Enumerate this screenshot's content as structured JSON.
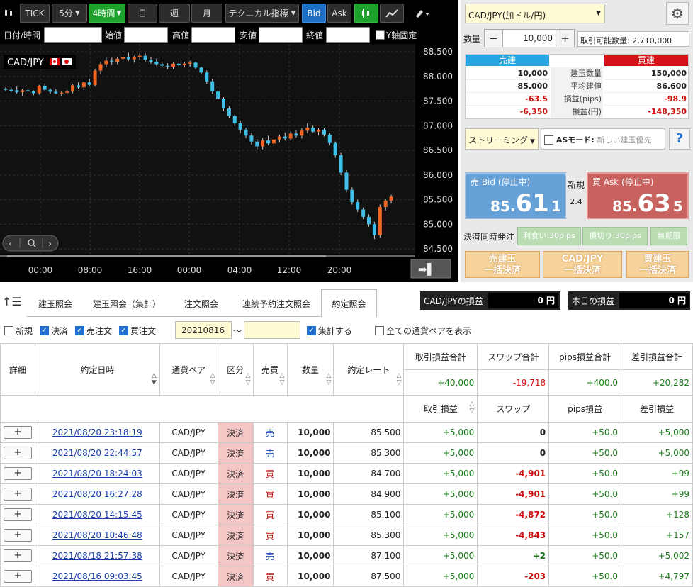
{
  "toolbar": {
    "tick": "TICK",
    "interval": "5分",
    "interval_active": "4時間",
    "day": "日",
    "week": "週",
    "month": "月",
    "indicator": "テクニカル指標",
    "bid": "Bid",
    "ask": "Ask"
  },
  "filter_row": {
    "datetime": "日付/時間",
    "open": "始値",
    "high": "高値",
    "low": "安値",
    "close": "終値",
    "y_fixed": "Y軸固定"
  },
  "chart_data": {
    "type": "candlestick",
    "symbol_label": "CAD/JPY",
    "ylim": [
      84.4,
      88.66
    ],
    "y_ticks": [
      "88.500",
      "88.000",
      "87.500",
      "87.000",
      "86.500",
      "86.000",
      "85.500",
      "85.000",
      "84.500"
    ],
    "x_ticks": [
      "00:00",
      "08:00",
      "16:00",
      "00:00",
      "04:00",
      "12:00",
      "20:00"
    ],
    "candles": [
      [
        87.75,
        87.78,
        87.7,
        87.73
      ],
      [
        87.73,
        87.77,
        87.68,
        87.72
      ],
      [
        87.72,
        87.8,
        87.65,
        87.68
      ],
      [
        87.68,
        87.75,
        87.6,
        87.72
      ],
      [
        87.72,
        87.8,
        87.66,
        87.7
      ],
      [
        87.7,
        87.72,
        87.62,
        87.66
      ],
      [
        87.66,
        87.83,
        87.63,
        87.81
      ],
      [
        87.81,
        87.86,
        87.71,
        87.73
      ],
      [
        87.73,
        87.76,
        87.65,
        87.69
      ],
      [
        87.69,
        87.74,
        87.64,
        87.66
      ],
      [
        87.66,
        87.7,
        87.61,
        87.67
      ],
      [
        87.67,
        87.72,
        87.62,
        87.7
      ],
      [
        87.7,
        87.84,
        87.66,
        87.82
      ],
      [
        87.82,
        87.88,
        87.75,
        87.78
      ],
      [
        87.78,
        87.9,
        87.72,
        87.88
      ],
      [
        87.88,
        87.95,
        87.8,
        87.83
      ],
      [
        87.83,
        88.15,
        87.8,
        88.12
      ],
      [
        88.12,
        88.3,
        88.05,
        88.25
      ],
      [
        88.25,
        88.4,
        88.18,
        88.32
      ],
      [
        88.32,
        88.38,
        88.24,
        88.3
      ],
      [
        88.3,
        88.4,
        88.25,
        88.36
      ],
      [
        88.36,
        88.45,
        88.3,
        88.4
      ],
      [
        88.4,
        88.48,
        88.32,
        88.35
      ],
      [
        88.35,
        88.42,
        88.28,
        88.4
      ],
      [
        88.4,
        88.47,
        88.33,
        88.42
      ],
      [
        88.42,
        88.47,
        88.3,
        88.34
      ],
      [
        88.34,
        88.4,
        88.26,
        88.3
      ],
      [
        88.3,
        88.36,
        88.22,
        88.25
      ],
      [
        88.25,
        88.3,
        88.18,
        88.22
      ],
      [
        88.22,
        88.27,
        88.15,
        88.2
      ],
      [
        88.2,
        88.28,
        88.15,
        88.26
      ],
      [
        88.26,
        88.32,
        88.2,
        88.23
      ],
      [
        88.23,
        88.3,
        88.18,
        88.26
      ],
      [
        88.26,
        88.32,
        88.2,
        88.28
      ],
      [
        88.28,
        88.3,
        88.15,
        88.18
      ],
      [
        88.18,
        88.2,
        88.05,
        88.08
      ],
      [
        88.08,
        88.12,
        87.85,
        87.9
      ],
      [
        87.9,
        87.95,
        87.65,
        87.7
      ],
      [
        87.7,
        87.73,
        87.5,
        87.55
      ],
      [
        87.55,
        87.58,
        87.3,
        87.35
      ],
      [
        87.35,
        87.4,
        87.15,
        87.2
      ],
      [
        87.2,
        87.23,
        87.0,
        87.05
      ],
      [
        87.05,
        87.1,
        86.85,
        86.92
      ],
      [
        86.92,
        86.96,
        86.75,
        86.8
      ],
      [
        86.8,
        86.85,
        86.62,
        86.68
      ],
      [
        86.68,
        86.73,
        86.52,
        86.58
      ],
      [
        86.58,
        86.75,
        86.52,
        86.7
      ],
      [
        86.7,
        86.8,
        86.6,
        86.64
      ],
      [
        86.64,
        86.78,
        86.58,
        86.72
      ],
      [
        86.72,
        86.82,
        86.66,
        86.78
      ],
      [
        86.78,
        86.86,
        86.7,
        86.74
      ],
      [
        86.74,
        86.88,
        86.7,
        86.84
      ],
      [
        86.84,
        86.9,
        86.76,
        86.8
      ],
      [
        86.8,
        86.95,
        86.74,
        86.9
      ],
      [
        86.9,
        87.05,
        86.85,
        86.96
      ],
      [
        86.96,
        87.0,
        86.86,
        86.88
      ],
      [
        86.88,
        86.95,
        86.8,
        86.92
      ],
      [
        86.92,
        86.95,
        86.78,
        86.82
      ],
      [
        86.82,
        86.85,
        86.6,
        86.65
      ],
      [
        86.65,
        86.68,
        86.35,
        86.4
      ],
      [
        86.4,
        86.45,
        86.0,
        86.05
      ],
      [
        86.05,
        86.1,
        85.65,
        85.7
      ],
      [
        85.7,
        85.75,
        85.4,
        85.45
      ],
      [
        85.45,
        85.5,
        85.25,
        85.3
      ],
      [
        85.3,
        85.34,
        85.1,
        85.15
      ],
      [
        85.15,
        85.2,
        84.95,
        85.0
      ],
      [
        85.0,
        85.05,
        84.7,
        84.78
      ],
      [
        84.78,
        85.4,
        84.72,
        85.35
      ],
      [
        85.35,
        85.52,
        85.28,
        85.48
      ],
      [
        85.48,
        85.6,
        85.42,
        85.56
      ]
    ]
  },
  "order": {
    "pair_select": "CAD/JPY(加ドル/円)",
    "qty_label": "数量",
    "qty_value": "10,000",
    "available": "取引可能数量: 2,710,000",
    "sell_header": "売建",
    "buy_header": "買建",
    "rows": [
      {
        "label": "建玉数量",
        "sell": "10,000",
        "buy": "150,000"
      },
      {
        "label": "平均建値",
        "sell": "85.000",
        "buy": "86.600"
      },
      {
        "label": "損益(pips)",
        "sell": "-63.5",
        "buy": "-98.9"
      },
      {
        "label": "損益(円)",
        "sell": "-6,350",
        "buy": "-148,350"
      }
    ],
    "streaming": "ストリーミング",
    "as_mode": "ASモード:",
    "as_mode_value": "新しい建玉優先",
    "help": "?",
    "bid_label": "売 Bid (停止中)",
    "bid_big": "85.",
    "bid_main": "61",
    "bid_small": "1",
    "ask_label": "買 Ask (停止中)",
    "ask_big": "85.",
    "ask_main": "63",
    "ask_small": "5",
    "new_label": "新規",
    "spread": "2.4",
    "settle_label": "決済同時発注",
    "take_profit": "利食い:30pips",
    "stop_loss": "損切り:30pips",
    "unlimited": "無期限",
    "btn_sell_top": "売建玉",
    "btn_sell_bottom": "一括決済",
    "btn_pair_top": "CAD/JPY",
    "btn_pair_bottom": "一括決済",
    "btn_buy_top": "買建玉",
    "btn_buy_bottom": "一括決済"
  },
  "tabs": [
    "建玉照会",
    "建玉照会（集計）",
    "注文照会",
    "連続予約注文照会",
    "約定照会"
  ],
  "pnl": {
    "pair_label": "CAD/JPYの損益",
    "pair_value": "0 円",
    "today_label": "本日の損益",
    "today_value": "0 円"
  },
  "filters": {
    "new": "新規",
    "settle": "決済",
    "sell_order": "売注文",
    "buy_order": "買注文",
    "date_from": "20210816",
    "tilde": "〜",
    "aggregate": "集計する",
    "show_all": "全ての通貨ペアを表示"
  },
  "table": {
    "headers": {
      "detail": "詳細",
      "datetime": "約定日時",
      "pair": "通貨ペア",
      "kubun": "区分",
      "side": "売買",
      "qty": "数量",
      "rate": "約定レート",
      "trade_pnl_total": "取引損益合計",
      "swap_total": "スワップ合計",
      "pips_total": "pips損益合計",
      "net_total": "差引損益合計",
      "trade_pnl": "取引損益",
      "swap": "スワップ",
      "pips": "pips損益",
      "net": "差引損益"
    },
    "totals": {
      "trade": "+40,000",
      "swap": "-19,718",
      "pips": "+400.0",
      "net": "+20,282"
    },
    "rows": [
      {
        "plus": "+",
        "dt": "2021/08/20 23:18:19",
        "pair": "CAD/JPY",
        "kubun": "決済",
        "side": "売",
        "qty": "10,000",
        "rate": "85.500",
        "trade": "+5,000",
        "swap": "0",
        "pips": "+50.0",
        "net": "+5,000"
      },
      {
        "plus": "+",
        "dt": "2021/08/20 22:44:57",
        "pair": "CAD/JPY",
        "kubun": "決済",
        "side": "売",
        "qty": "10,000",
        "rate": "85.300",
        "trade": "+5,000",
        "swap": "0",
        "pips": "+50.0",
        "net": "+5,000"
      },
      {
        "plus": "+",
        "dt": "2021/08/20 18:24:03",
        "pair": "CAD/JPY",
        "kubun": "決済",
        "side": "買",
        "qty": "10,000",
        "rate": "84.700",
        "trade": "+5,000",
        "swap": "-4,901",
        "pips": "+50.0",
        "net": "+99"
      },
      {
        "plus": "+",
        "dt": "2021/08/20 16:27:28",
        "pair": "CAD/JPY",
        "kubun": "決済",
        "side": "買",
        "qty": "10,000",
        "rate": "84.900",
        "trade": "+5,000",
        "swap": "-4,901",
        "pips": "+50.0",
        "net": "+99"
      },
      {
        "plus": "+",
        "dt": "2021/08/20 14:15:45",
        "pair": "CAD/JPY",
        "kubun": "決済",
        "side": "買",
        "qty": "10,000",
        "rate": "85.100",
        "trade": "+5,000",
        "swap": "-4,872",
        "pips": "+50.0",
        "net": "+128"
      },
      {
        "plus": "+",
        "dt": "2021/08/20 10:46:48",
        "pair": "CAD/JPY",
        "kubun": "決済",
        "side": "買",
        "qty": "10,000",
        "rate": "85.300",
        "trade": "+5,000",
        "swap": "-4,843",
        "pips": "+50.0",
        "net": "+157"
      },
      {
        "plus": "+",
        "dt": "2021/08/18 21:57:38",
        "pair": "CAD/JPY",
        "kubun": "決済",
        "side": "売",
        "qty": "10,000",
        "rate": "87.100",
        "trade": "+5,000",
        "swap": "+2",
        "pips": "+50.0",
        "net": "+5,002"
      },
      {
        "plus": "+",
        "dt": "2021/08/16 09:03:45",
        "pair": "CAD/JPY",
        "kubun": "決済",
        "side": "買",
        "qty": "10,000",
        "rate": "87.500",
        "trade": "+5,000",
        "swap": "-203",
        "pips": "+50.0",
        "net": "+4,797"
      }
    ]
  },
  "colors": {
    "up": "#f26522",
    "down": "#3fc0e8",
    "sell_blue": "#3e7bc9",
    "buy_red": "#c0392b",
    "positive": "#1a7a1a",
    "negative": "#d01010"
  }
}
